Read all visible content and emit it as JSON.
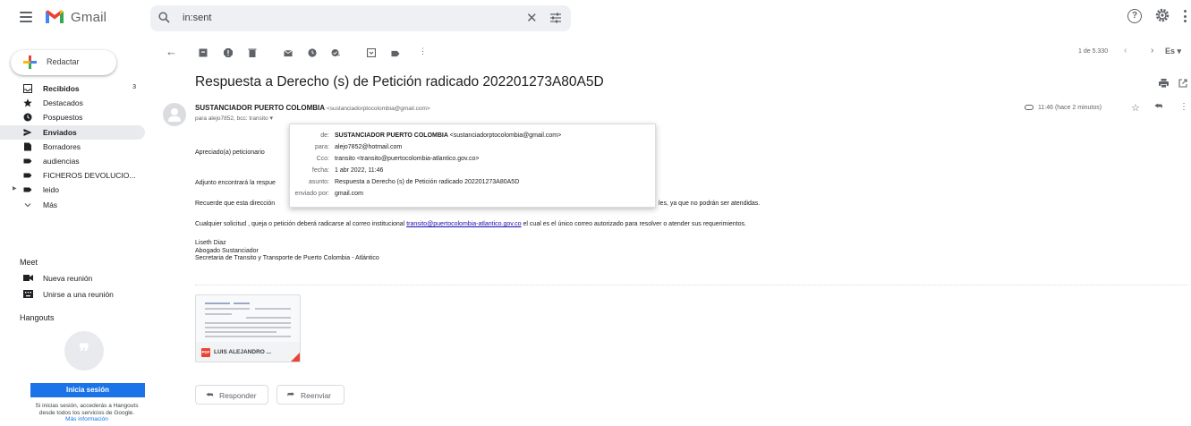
{
  "app": {
    "brand": "Gmail",
    "accent": "#1a73e8",
    "logo_colors": [
      "#ea4335",
      "#fbbc04",
      "#34a853",
      "#4285f4"
    ]
  },
  "search": {
    "value": "in:sent",
    "icon": "search-icon",
    "clear_icon": "close-icon",
    "options_icon": "tune-icon"
  },
  "header_icons": [
    "help-icon",
    "gear-icon",
    "apps-icon"
  ],
  "compose": {
    "label": "Redactar"
  },
  "sidebar": {
    "items": [
      {
        "label": "Recibidos",
        "count": "3",
        "icon": "inbox-icon",
        "bold": true
      },
      {
        "label": "Destacados",
        "icon": "star-icon"
      },
      {
        "label": "Pospuestos",
        "icon": "clock-icon"
      },
      {
        "label": "Enviados",
        "icon": "send-icon",
        "bold": true,
        "active": true
      },
      {
        "label": "Borradores",
        "icon": "draft-icon"
      },
      {
        "label": "audiencias",
        "icon": "label-icon"
      },
      {
        "label": "FICHEROS DEVOLUCIO...",
        "icon": "label-icon"
      },
      {
        "label": "leido",
        "icon": "label-icon",
        "expandable": true
      },
      {
        "label": "Más",
        "icon": "chevron-down-icon"
      }
    ]
  },
  "meet": {
    "title": "Meet",
    "items": [
      {
        "label": "Nueva reunión",
        "icon": "video-icon"
      },
      {
        "label": "Unirse a una reunión",
        "icon": "keyboard-icon"
      }
    ]
  },
  "hangouts": {
    "title": "Hangouts",
    "signin": "Inicia sesión",
    "info_line1": "Si inicias sesión, accederás a Hangouts",
    "info_line2": "desde todos los servicios de Google.",
    "more_info": "Más información"
  },
  "toolbar": {
    "icons": [
      "back-arrow-icon",
      "archive-icon",
      "report-spam-icon",
      "delete-icon",
      "mark-unread-icon",
      "snooze-icon",
      "add-task-icon",
      "move-to-icon",
      "label-icon",
      "more-icon"
    ],
    "pagination": "1 de 5.330",
    "lang": "Es"
  },
  "message": {
    "subject": "Respuesta a Derecho (s) de Petición radicado 202201273A80A5D",
    "sender_name": "SUSTANCIADOR PUERTO COLOMBIA",
    "sender_email": "<sustanciadorptocolombia@gmail.com>",
    "recipients": "para alejo7852, bcc: transito",
    "time": "11:46 (hace 2 minutos)",
    "body": {
      "greeting": "Apreciado(a) peticionario",
      "line1": "Adjunto encontrará la respue",
      "line2a": "Recuerde que esta dirección",
      "line2b": "les, ya que no podrán ser atendidas.",
      "line3_pre": "Cualquier solicitud , queja o petición deberá radicarse al correo institucional ",
      "line3_link": "transito@puertocolombia-atlantico.gov.co",
      "line3_post": " el cual es el único correo autorizado para resolver o atender sus requerimientos.",
      "sig1": "Liseth Diaz",
      "sig2": "Abogado Sustanciador",
      "sig3": "Secretaria de Transito y Transporte de Puerto Colombia - Atlántico"
    },
    "attachment": {
      "name": "LUIS ALEJANDRO ...",
      "type": "PDF"
    },
    "actions": {
      "reply": "Responder",
      "forward": "Reenviar"
    }
  },
  "details": {
    "de_label": "de:",
    "de_name": "SUSTANCIADOR PUERTO COLOMBIA",
    "de_email": "<sustanciadorptocolombia@gmail.com>",
    "para_label": "para:",
    "para_value": "alejo7852@hotmail.com",
    "cco_label": "Cco:",
    "cco_value": "transito <transito@puertocolombia-atlantico.gov.co>",
    "fecha_label": "fecha:",
    "fecha_value": "1 abr 2022, 11:46",
    "asunto_label": "asunto:",
    "asunto_value": "Respuesta a Derecho (s) de Petición radicado 202201273A80A5D",
    "enviado_label": "enviado por:",
    "enviado_value": "gmail.com"
  }
}
